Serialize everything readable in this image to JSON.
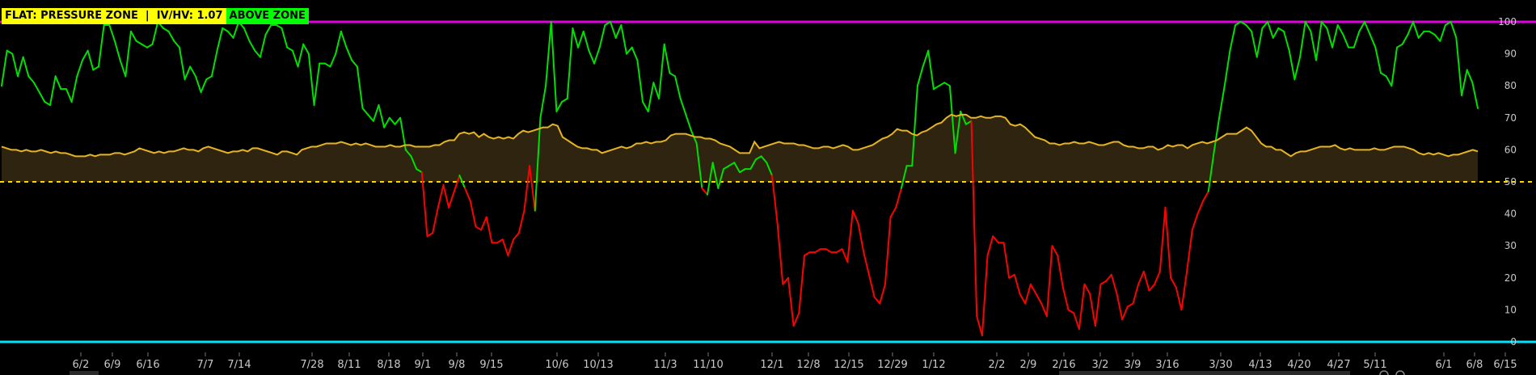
{
  "header": {
    "badge_status": "FLAT: PRESSURE ZONE  |  IV/HV: 1.07",
    "badge_zone": "ABOVE ZONE"
  },
  "colors": {
    "background": "#000000",
    "upper_line": "#e000e0",
    "lower_line": "#00e5ff",
    "midline": "#ffd700",
    "above_color": "#00e000",
    "below_color": "#ff0000",
    "orange_line": "#e6b422",
    "fill": "#2e2410",
    "badge_status_bg": "#ffff00",
    "badge_zone_bg": "#00ff00"
  },
  "chart_data": {
    "type": "line",
    "ylim": [
      0,
      100
    ],
    "y_ticks": [
      0,
      10,
      20,
      30,
      40,
      50,
      60,
      70,
      80,
      90,
      100
    ],
    "x_tick_labels": [
      "6/2",
      "6/9",
      "6/16",
      "7/7",
      "7/14",
      "7/28",
      "8/11",
      "8/18",
      "9/1",
      "9/8",
      "9/15",
      "10/6",
      "10/13",
      "11/3",
      "11/10",
      "12/1",
      "12/8",
      "12/15",
      "12/29",
      "1/12",
      "2/2",
      "2/9",
      "2/16",
      "3/2",
      "3/9",
      "3/16",
      "3/30",
      "4/13",
      "4/20",
      "4/27",
      "5/11",
      "6/1",
      "6/8",
      "6/15"
    ],
    "reference_lines": [
      {
        "value": 100,
        "style": "solid",
        "color": "#e000e0"
      },
      {
        "value": 50,
        "style": "dashed",
        "color": "#ffd700"
      },
      {
        "value": 0,
        "style": "solid",
        "color": "#00e5ff"
      }
    ],
    "oscillator": {
      "threshold": 50,
      "values": [
        80,
        91,
        90,
        83,
        89,
        83,
        81,
        78,
        75,
        74,
        83,
        79,
        79,
        75,
        83,
        88,
        91,
        85,
        86,
        99,
        99,
        94,
        88,
        83,
        97,
        94,
        93,
        92,
        93,
        100,
        98,
        97,
        94,
        92,
        82,
        86,
        83,
        78,
        82,
        83,
        91,
        98,
        97,
        95,
        100,
        98,
        94,
        91,
        89,
        96,
        99,
        99,
        98,
        92,
        91,
        86,
        93,
        90,
        74,
        87,
        87,
        86,
        90,
        97,
        92,
        88,
        86,
        73,
        71,
        69,
        74,
        67,
        70,
        68,
        70,
        60,
        58,
        54,
        53,
        33,
        34,
        42,
        49,
        42,
        47,
        52,
        48,
        44,
        36,
        35,
        39,
        31,
        31,
        32,
        27,
        32,
        34,
        41,
        55,
        41,
        70,
        80,
        100,
        72,
        75,
        76,
        98,
        92,
        97,
        91,
        87,
        92,
        99,
        100,
        95,
        99,
        90,
        92,
        88,
        75,
        72,
        81,
        76,
        93,
        84,
        83,
        76,
        71,
        66,
        62,
        48,
        46,
        56,
        48,
        54,
        55,
        56,
        53,
        54,
        54,
        57,
        58,
        56,
        52,
        37,
        18,
        20,
        5,
        9,
        27,
        28,
        28,
        29,
        29,
        28,
        28,
        29,
        25,
        41,
        37,
        28,
        21,
        14,
        12,
        18,
        39,
        42,
        48,
        55,
        55,
        80,
        86,
        91,
        79,
        80,
        81,
        80,
        59,
        72,
        68,
        69,
        8,
        2,
        27,
        33,
        31,
        31,
        20,
        21,
        15,
        12,
        18,
        15,
        12,
        8,
        30,
        27,
        17,
        10,
        9,
        4,
        18,
        15,
        5,
        18,
        19,
        21,
        15,
        7,
        11,
        12,
        18,
        22,
        16,
        18,
        22,
        42,
        20,
        17,
        10,
        22,
        35,
        40,
        44,
        47,
        59,
        70,
        80,
        91,
        99,
        100,
        99,
        97,
        89,
        98,
        100,
        95,
        98,
        97,
        91,
        82,
        89,
        100,
        97,
        88,
        100,
        98,
        92,
        99,
        96,
        92,
        92,
        97,
        100,
        96,
        92,
        84,
        83,
        80,
        92,
        93,
        96,
        100,
        95,
        97,
        97,
        96,
        94,
        99,
        100,
        95,
        77,
        85,
        81,
        73
      ]
    },
    "smoothed_line": {
      "values": [
        61,
        60.5,
        60,
        60,
        59.5,
        60,
        59.5,
        59.5,
        60,
        59.5,
        59,
        59.5,
        59,
        59,
        58.5,
        58,
        58,
        58,
        58.5,
        58,
        58.5,
        58.5,
        58.5,
        59,
        59,
        58.5,
        59,
        59.5,
        60.5,
        60,
        59.5,
        59,
        59.5,
        59,
        59.5,
        59.5,
        60,
        60.5,
        60,
        60,
        59.5,
        60.5,
        61,
        60.5,
        60,
        59.5,
        59,
        59.5,
        59.5,
        60,
        59.5,
        60.5,
        60.5,
        60,
        59.5,
        59,
        58.5,
        59.5,
        59.5,
        59,
        58.5,
        60,
        60.5,
        61,
        61,
        61.5,
        62,
        62,
        62,
        62.5,
        62,
        61.5,
        62,
        61.5,
        62,
        61.5,
        61,
        61,
        61,
        61.5,
        61,
        61,
        61.5,
        61.5,
        61,
        61,
        61,
        61,
        61.5,
        61.5,
        62.5,
        63,
        63,
        65,
        65.5,
        65,
        65.5,
        64,
        65,
        64,
        63.5,
        64,
        63.5,
        64,
        63.5,
        65,
        66,
        65.5,
        66,
        66.5,
        67,
        67,
        68,
        67.5,
        64,
        63,
        62,
        61,
        60.5,
        60.5,
        60,
        60,
        59,
        59.5,
        60,
        60.5,
        61,
        60.5,
        61,
        62,
        62,
        62.5,
        62,
        62.5,
        62.5,
        63,
        64.5,
        65,
        65,
        65,
        64.5,
        64,
        64,
        63.5,
        63.5,
        63,
        62,
        61.5,
        61,
        60,
        59,
        59,
        59,
        62.5,
        60.5,
        61,
        61.5,
        62,
        62.5,
        62,
        62,
        62,
        61.5,
        61.5,
        61,
        60.5,
        60.5,
        61,
        61,
        60.5,
        61,
        61.5,
        61,
        60,
        60,
        60.5,
        61,
        61.5,
        62.5,
        63.5,
        64,
        65,
        66.5,
        66,
        66,
        65,
        64.5,
        65.5,
        66,
        67,
        68,
        68.5,
        70,
        71,
        70.5,
        71,
        71,
        70,
        70,
        70.5,
        70,
        70,
        70.5,
        70.5,
        70,
        68,
        67.5,
        68,
        67,
        65.5,
        64,
        63.5,
        63,
        62,
        62,
        61.5,
        62,
        62,
        62.5,
        62,
        62,
        62.5,
        62,
        61.5,
        61.5,
        62,
        62.5,
        62.5,
        61.5,
        61,
        61,
        60.5,
        60.5,
        61,
        61,
        60,
        60.5,
        61.5,
        61,
        61.5,
        61.5,
        60.5,
        61.5,
        62,
        62.5,
        62,
        62.5,
        63,
        64,
        65,
        65,
        65,
        66,
        67,
        66,
        64,
        62,
        61,
        61,
        60,
        60,
        59,
        58,
        59,
        59.5,
        59.5,
        60,
        60.5,
        61,
        61,
        61,
        61.5,
        60.5,
        60,
        60.5,
        60,
        60,
        60,
        60,
        60.5,
        60,
        60,
        60.5,
        61,
        61,
        61,
        60.5,
        60,
        59,
        58.5,
        59,
        58.5,
        59,
        58.5,
        58,
        58.5,
        58.5,
        59,
        59.5,
        60,
        59.5
      ]
    }
  }
}
